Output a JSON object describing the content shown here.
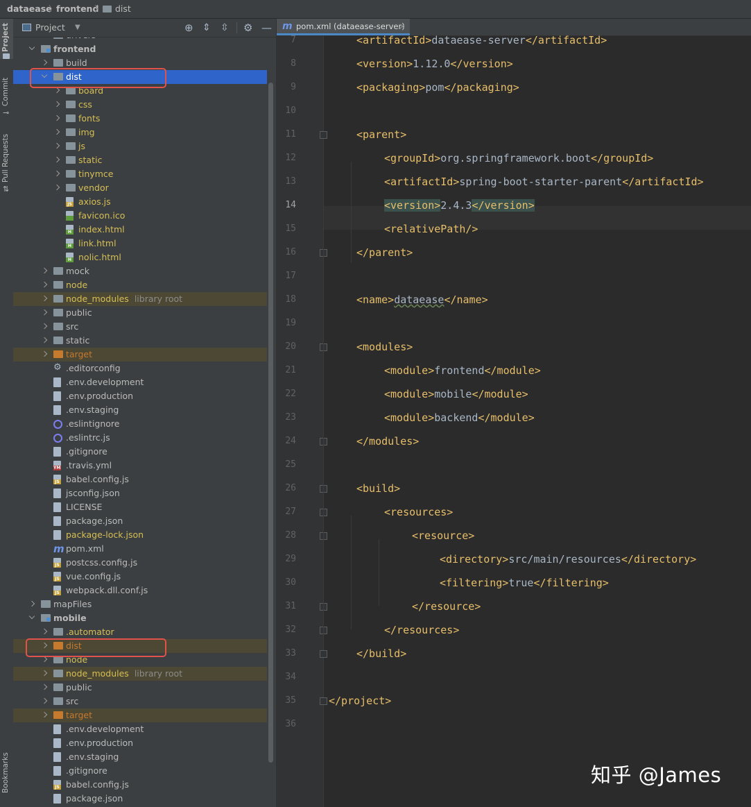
{
  "breadcrumb": [
    "dataease",
    "frontend",
    "dist"
  ],
  "stripe": {
    "project_label": "Project",
    "commit_label": "Commit",
    "pull_requests_label": "Pull Requests",
    "bookmarks_label": "Bookmarks"
  },
  "panel": {
    "title": "Project"
  },
  "tree": [
    {
      "label": "drivers",
      "kind": "folder",
      "depth": 2,
      "state": "collapsed"
    },
    {
      "label": "frontend",
      "kind": "module",
      "depth": 1,
      "state": "expanded",
      "bold": true
    },
    {
      "label": "build",
      "kind": "folder",
      "depth": 2,
      "state": "collapsed"
    },
    {
      "label": "dist",
      "kind": "folder",
      "depth": 2,
      "state": "expanded",
      "selected": true,
      "highlight": true
    },
    {
      "label": "board",
      "kind": "folder",
      "depth": 3,
      "state": "collapsed",
      "color": "yellow"
    },
    {
      "label": "css",
      "kind": "folder",
      "depth": 3,
      "state": "collapsed",
      "color": "yellow"
    },
    {
      "label": "fonts",
      "kind": "folder",
      "depth": 3,
      "state": "collapsed",
      "color": "yellow"
    },
    {
      "label": "img",
      "kind": "folder",
      "depth": 3,
      "state": "collapsed",
      "color": "yellow"
    },
    {
      "label": "js",
      "kind": "folder",
      "depth": 3,
      "state": "collapsed",
      "color": "yellow"
    },
    {
      "label": "static",
      "kind": "folder",
      "depth": 3,
      "state": "collapsed",
      "color": "yellow"
    },
    {
      "label": "tinymce",
      "kind": "folder",
      "depth": 3,
      "state": "collapsed",
      "color": "yellow"
    },
    {
      "label": "vendor",
      "kind": "folder",
      "depth": 3,
      "state": "collapsed",
      "color": "yellow"
    },
    {
      "label": "axios.js",
      "kind": "js",
      "depth": 3,
      "color": "yellow"
    },
    {
      "label": "favicon.ico",
      "kind": "ico",
      "depth": 3,
      "color": "yellow"
    },
    {
      "label": "index.html",
      "kind": "html",
      "depth": 3,
      "color": "yellow"
    },
    {
      "label": "link.html",
      "kind": "html",
      "depth": 3,
      "color": "yellow"
    },
    {
      "label": "nolic.html",
      "kind": "html",
      "depth": 3,
      "color": "yellow"
    },
    {
      "label": "mock",
      "kind": "folder",
      "depth": 2,
      "state": "collapsed"
    },
    {
      "label": "node",
      "kind": "folder",
      "depth": 2,
      "state": "collapsed",
      "color": "yellow"
    },
    {
      "label": "node_modules",
      "kind": "folder",
      "depth": 2,
      "state": "collapsed",
      "color": "yellow",
      "extra": "library root",
      "excluded": true
    },
    {
      "label": "public",
      "kind": "folder",
      "depth": 2,
      "state": "collapsed"
    },
    {
      "label": "src",
      "kind": "folder",
      "depth": 2,
      "state": "collapsed"
    },
    {
      "label": "static",
      "kind": "folder",
      "depth": 2,
      "state": "collapsed"
    },
    {
      "label": "target",
      "kind": "folder-orange",
      "depth": 2,
      "state": "collapsed",
      "color": "orange",
      "excluded": true
    },
    {
      "label": ".editorconfig",
      "kind": "gear",
      "depth": 2
    },
    {
      "label": ".env.development",
      "kind": "file",
      "depth": 2
    },
    {
      "label": ".env.production",
      "kind": "file",
      "depth": 2
    },
    {
      "label": ".env.staging",
      "kind": "file",
      "depth": 2
    },
    {
      "label": ".eslintignore",
      "kind": "ring",
      "depth": 2
    },
    {
      "label": ".eslintrc.js",
      "kind": "ring",
      "depth": 2
    },
    {
      "label": ".gitignore",
      "kind": "file",
      "depth": 2
    },
    {
      "label": ".travis.yml",
      "kind": "yml",
      "depth": 2
    },
    {
      "label": "babel.config.js",
      "kind": "js",
      "depth": 2
    },
    {
      "label": "jsconfig.json",
      "kind": "file",
      "depth": 2
    },
    {
      "label": "LICENSE",
      "kind": "file",
      "depth": 2
    },
    {
      "label": "package.json",
      "kind": "file",
      "depth": 2
    },
    {
      "label": "package-lock.json",
      "kind": "file",
      "depth": 2,
      "color": "yellow"
    },
    {
      "label": "pom.xml",
      "kind": "maven",
      "depth": 2
    },
    {
      "label": "postcss.config.js",
      "kind": "js",
      "depth": 2
    },
    {
      "label": "vue.config.js",
      "kind": "js",
      "depth": 2
    },
    {
      "label": "webpack.dll.conf.js",
      "kind": "js",
      "depth": 2
    },
    {
      "label": "mapFiles",
      "kind": "folder",
      "depth": 1,
      "state": "collapsed"
    },
    {
      "label": "mobile",
      "kind": "module",
      "depth": 1,
      "state": "expanded",
      "bold": true
    },
    {
      "label": ".automator",
      "kind": "folder",
      "depth": 2,
      "state": "collapsed",
      "color": "yellow"
    },
    {
      "label": "dist",
      "kind": "folder-orange",
      "depth": 2,
      "state": "collapsed",
      "color": "orange",
      "excluded": true,
      "highlight": true
    },
    {
      "label": "node",
      "kind": "folder",
      "depth": 2,
      "state": "collapsed",
      "color": "yellow"
    },
    {
      "label": "node_modules",
      "kind": "folder",
      "depth": 2,
      "state": "collapsed",
      "color": "yellow",
      "extra": "library root",
      "excluded": true
    },
    {
      "label": "public",
      "kind": "folder",
      "depth": 2,
      "state": "collapsed"
    },
    {
      "label": "src",
      "kind": "folder",
      "depth": 2,
      "state": "collapsed"
    },
    {
      "label": "target",
      "kind": "folder-orange",
      "depth": 2,
      "state": "collapsed",
      "color": "orange",
      "excluded": true
    },
    {
      "label": ".env.development",
      "kind": "file",
      "depth": 2
    },
    {
      "label": ".env.production",
      "kind": "file",
      "depth": 2
    },
    {
      "label": ".env.staging",
      "kind": "file",
      "depth": 2
    },
    {
      "label": ".gitignore",
      "kind": "file",
      "depth": 2
    },
    {
      "label": "babel.config.js",
      "kind": "js",
      "depth": 2
    },
    {
      "label": "package.json",
      "kind": "file",
      "depth": 2
    }
  ],
  "editor": {
    "tab_label": "pom.xml (dataease-server)",
    "current_line": 14,
    "lines": [
      {
        "n": 7,
        "indent": 1,
        "parts": [
          [
            "t",
            "<artifactId>"
          ],
          [
            "x",
            "dataease-server"
          ],
          [
            "t",
            "</artifactId>"
          ]
        ]
      },
      {
        "n": 8,
        "indent": 1,
        "parts": [
          [
            "t",
            "<version>"
          ],
          [
            "x",
            "1.12.0"
          ],
          [
            "t",
            "</version>"
          ]
        ]
      },
      {
        "n": 9,
        "indent": 1,
        "parts": [
          [
            "t",
            "<packaging>"
          ],
          [
            "x",
            "pom"
          ],
          [
            "t",
            "</packaging>"
          ]
        ]
      },
      {
        "n": 10,
        "indent": 0,
        "parts": []
      },
      {
        "n": 11,
        "indent": 1,
        "parts": [
          [
            "t",
            "<parent>"
          ]
        ],
        "fold": true
      },
      {
        "n": 12,
        "indent": 2,
        "parts": [
          [
            "t",
            "<groupId>"
          ],
          [
            "x",
            "org.springframework.boot"
          ],
          [
            "t",
            "</groupId>"
          ]
        ]
      },
      {
        "n": 13,
        "indent": 2,
        "parts": [
          [
            "t",
            "<artifactId>"
          ],
          [
            "x",
            "spring-boot-starter-parent"
          ],
          [
            "t",
            "</artifactId>"
          ]
        ]
      },
      {
        "n": 14,
        "indent": 2,
        "parts": [
          [
            "th",
            "<version>"
          ],
          [
            "x",
            "2.4.3"
          ],
          [
            "th",
            "</version>"
          ]
        ]
      },
      {
        "n": 15,
        "indent": 2,
        "parts": [
          [
            "t",
            "<relativePath/>"
          ]
        ]
      },
      {
        "n": 16,
        "indent": 1,
        "parts": [
          [
            "t",
            "</parent>"
          ]
        ],
        "fold": true
      },
      {
        "n": 17,
        "indent": 0,
        "parts": []
      },
      {
        "n": 18,
        "indent": 1,
        "parts": [
          [
            "t",
            "<name>"
          ],
          [
            "xs",
            "dataease"
          ],
          [
            "t",
            "</name>"
          ]
        ]
      },
      {
        "n": 19,
        "indent": 0,
        "parts": []
      },
      {
        "n": 20,
        "indent": 1,
        "parts": [
          [
            "t",
            "<modules>"
          ]
        ],
        "fold": true
      },
      {
        "n": 21,
        "indent": 2,
        "parts": [
          [
            "t",
            "<module>"
          ],
          [
            "x",
            "frontend"
          ],
          [
            "t",
            "</module>"
          ]
        ]
      },
      {
        "n": 22,
        "indent": 2,
        "parts": [
          [
            "t",
            "<module>"
          ],
          [
            "x",
            "mobile"
          ],
          [
            "t",
            "</module>"
          ]
        ]
      },
      {
        "n": 23,
        "indent": 2,
        "parts": [
          [
            "t",
            "<module>"
          ],
          [
            "x",
            "backend"
          ],
          [
            "t",
            "</module>"
          ]
        ]
      },
      {
        "n": 24,
        "indent": 1,
        "parts": [
          [
            "t",
            "</modules>"
          ]
        ],
        "fold": true
      },
      {
        "n": 25,
        "indent": 0,
        "parts": []
      },
      {
        "n": 26,
        "indent": 1,
        "parts": [
          [
            "t",
            "<build>"
          ]
        ],
        "fold": true
      },
      {
        "n": 27,
        "indent": 2,
        "parts": [
          [
            "t",
            "<resources>"
          ]
        ],
        "fold": true
      },
      {
        "n": 28,
        "indent": 3,
        "parts": [
          [
            "t",
            "<resource>"
          ]
        ],
        "fold": true
      },
      {
        "n": 29,
        "indent": 4,
        "parts": [
          [
            "t",
            "<directory>"
          ],
          [
            "x",
            "src/main/resources"
          ],
          [
            "t",
            "</directory>"
          ]
        ]
      },
      {
        "n": 30,
        "indent": 4,
        "parts": [
          [
            "t",
            "<filtering>"
          ],
          [
            "x",
            "true"
          ],
          [
            "t",
            "</filtering>"
          ]
        ]
      },
      {
        "n": 31,
        "indent": 3,
        "parts": [
          [
            "t",
            "</resource>"
          ]
        ],
        "fold": true
      },
      {
        "n": 32,
        "indent": 2,
        "parts": [
          [
            "t",
            "</resources>"
          ]
        ],
        "fold": true
      },
      {
        "n": 33,
        "indent": 1,
        "parts": [
          [
            "t",
            "</build>"
          ]
        ],
        "fold": true
      },
      {
        "n": 34,
        "indent": 0,
        "parts": []
      },
      {
        "n": 35,
        "indent": 0,
        "parts": [
          [
            "t",
            "</project>"
          ]
        ],
        "fold": true
      },
      {
        "n": 36,
        "indent": 0,
        "parts": []
      }
    ]
  },
  "watermark": "知乎 @James",
  "colors": {
    "tag": "#e8bf6a",
    "text": "#a9b7c6",
    "selection": "#2f65ca",
    "highlight_box": "#e0524a",
    "excluded_folder": "#c57a2e",
    "generated_file": "#d6bf55"
  }
}
